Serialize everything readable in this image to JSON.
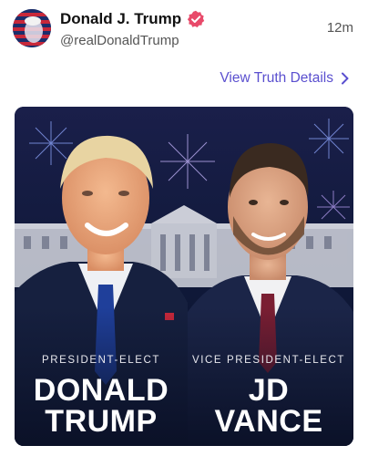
{
  "post": {
    "author_name": "Donald J. Trump",
    "handle": "@realDonaldTrump",
    "timestamp": "12m",
    "verified": true,
    "details_link": "View Truth Details",
    "accent_color": "#5a4fcf",
    "verified_color": "#e84a6a"
  },
  "media": {
    "left": {
      "role": "PRESIDENT-ELECT",
      "name_line1": "DONALD",
      "name_line2": "TRUMP"
    },
    "right": {
      "role": "VICE PRESIDENT-ELECT",
      "name_line1": "JD",
      "name_line2": "VANCE"
    }
  }
}
